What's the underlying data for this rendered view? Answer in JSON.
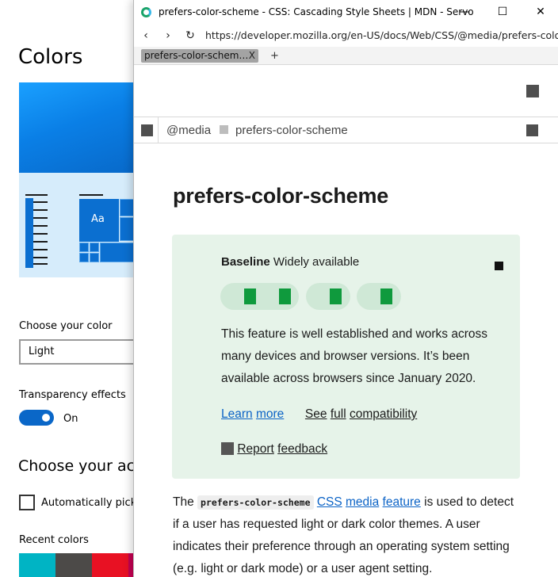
{
  "settings": {
    "title": "Colors",
    "preview_sample_text": "Aa",
    "choose_color_label": "Choose your color",
    "choose_color_value": "Light",
    "transparency_label": "Transparency effects",
    "transparency_state": "On",
    "accent_heading": "Choose your acc",
    "auto_pick_label": "Automatically pick",
    "recent_colors_label": "Recent colors",
    "recent_colors": [
      "#00b4c4",
      "#4c4a48",
      "#e81123",
      "#c30052"
    ]
  },
  "browser": {
    "window_title": "prefers-color-scheme - CSS: Cascading Style Sheets | MDN - Servo",
    "controls": {
      "minimize": "—",
      "maximize": "☐",
      "close": "✕"
    },
    "nav": {
      "back": "‹",
      "forward": "›",
      "reload": "↻"
    },
    "url": "https://developer.mozilla.org/en-US/docs/Web/CSS/@media/prefers-color-scheme",
    "tab": {
      "label": "prefers-color-schem…",
      "close": "X"
    },
    "new_tab": "+"
  },
  "page": {
    "breadcrumbs": [
      "@media",
      "prefers-color-scheme"
    ],
    "heading": "prefers-color-scheme",
    "baseline": {
      "label_bold": "Baseline",
      "label_rest": "Widely available",
      "description": "This feature is well established and works across many devices and browser versions. It’s been available across browsers since January 2020.",
      "learn": "Learn",
      "more": "more",
      "see": "See",
      "full": "full",
      "compatibility": "compatibility",
      "report": "Report",
      "feedback": "feedback"
    },
    "intro": {
      "the": "The",
      "code": "prefers-color-scheme",
      "link_css": "CSS",
      "link_media": "media",
      "link_feature": "feature",
      "rest": "is used to detect if a user has requested light or dark color themes. A user indicates their preference through an operating system setting (e.g. light or dark mode) or a user agent setting."
    }
  },
  "colors": {
    "accent": "#0a67c8",
    "link": "#0b63c6",
    "baseline_bg": "#e6f3e9",
    "baseline_green": "#0f9a3d"
  }
}
